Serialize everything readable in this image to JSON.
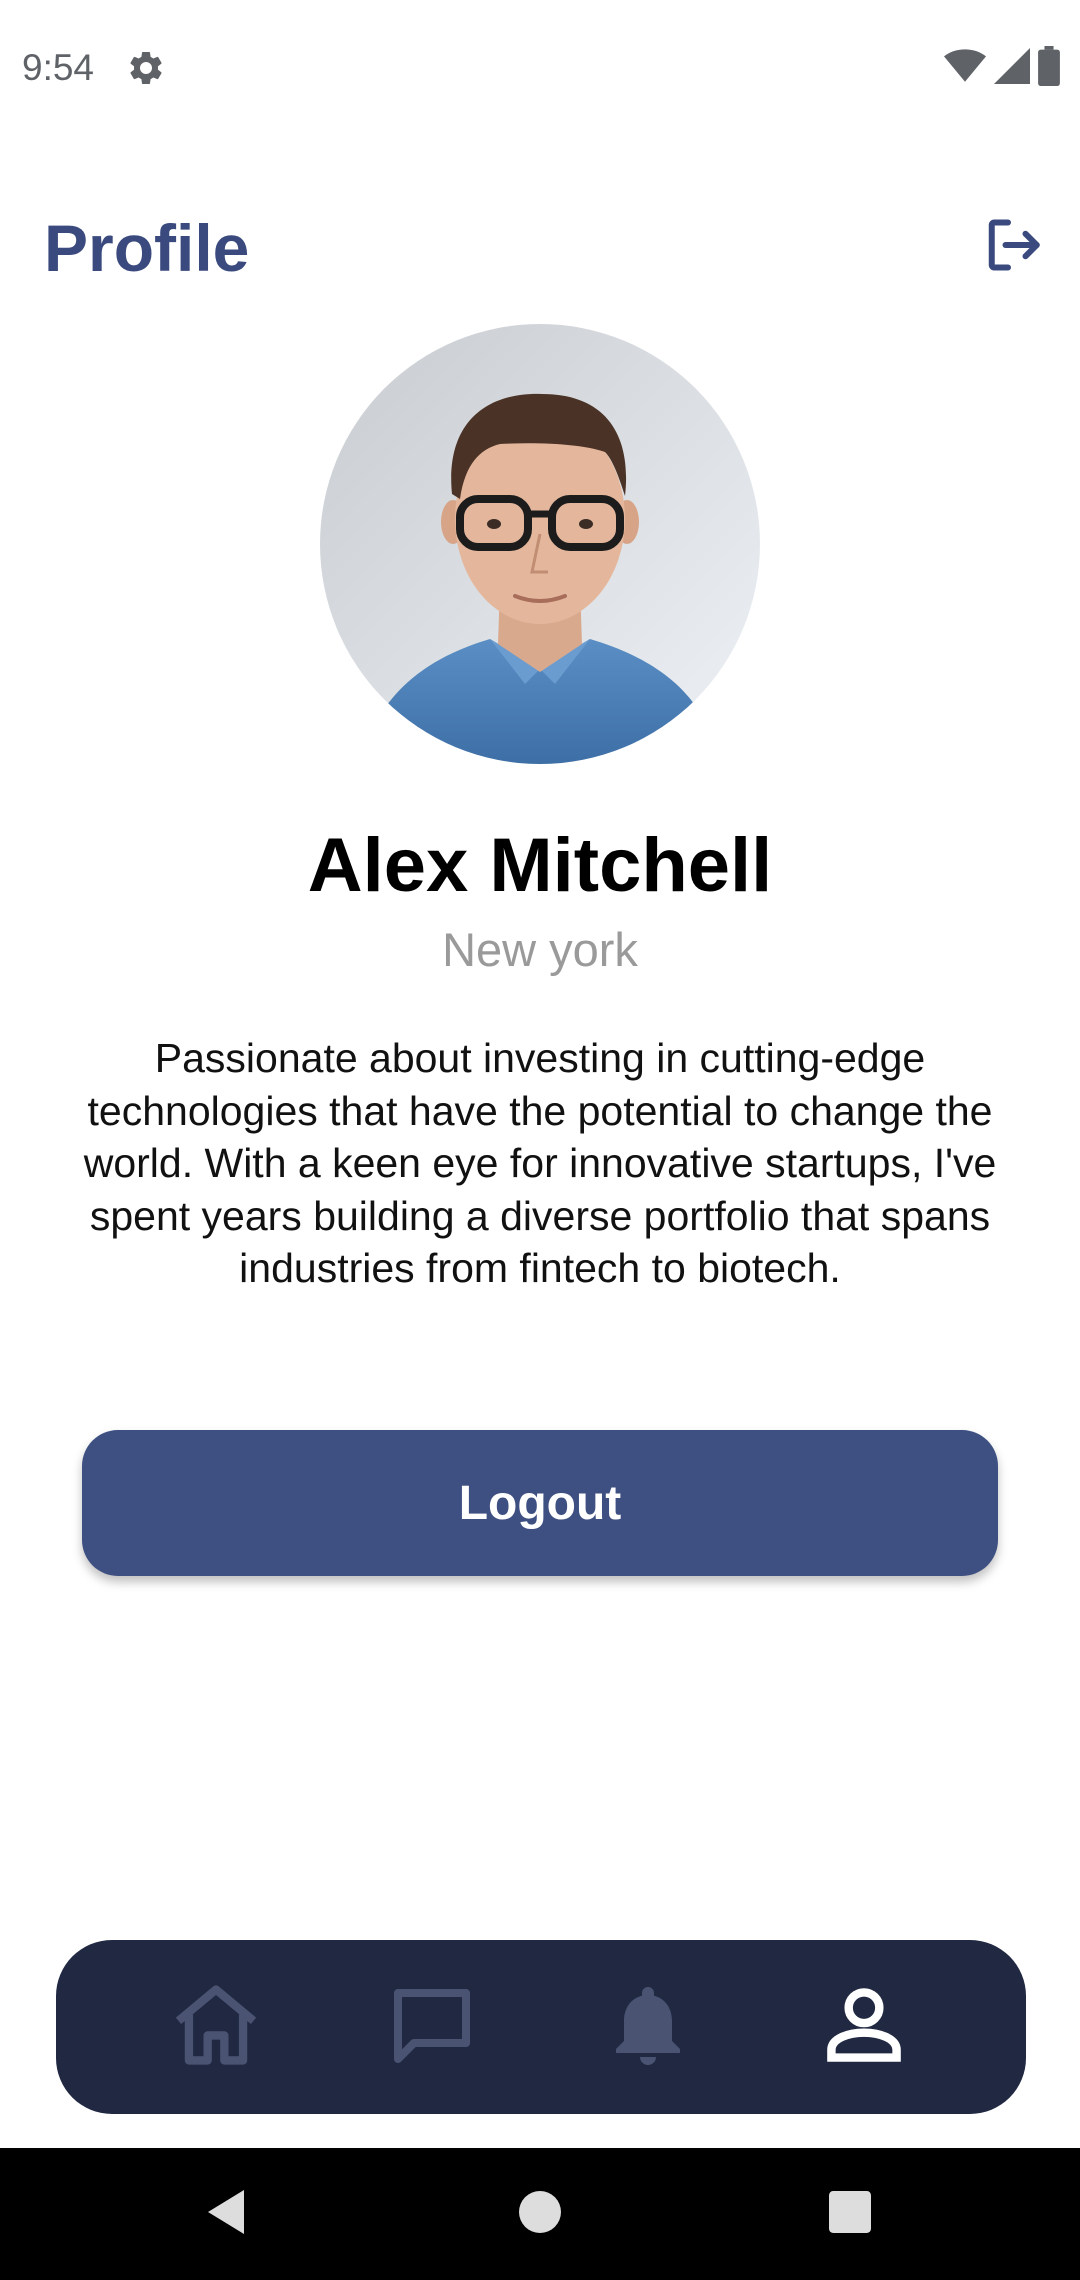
{
  "status_bar": {
    "time": "9:54",
    "icons": [
      "gear-icon",
      "wifi-icon",
      "signal-icon",
      "battery-icon"
    ]
  },
  "header": {
    "title": "Profile",
    "exit_icon": "logout-icon"
  },
  "profile": {
    "name": "Alex Mitchell",
    "location": "New york",
    "bio": "Passionate about investing in cutting-edge technologies that have the potential to change the world. With a keen eye for innovative startups, I've spent years building a diverse portfolio that spans industries from fintech to biotech."
  },
  "logout_button": {
    "label": "Logout"
  },
  "bottom_nav": {
    "items": [
      {
        "icon": "home-icon",
        "active": false
      },
      {
        "icon": "chat-icon",
        "active": false
      },
      {
        "icon": "bell-icon",
        "active": false
      },
      {
        "icon": "person-icon",
        "active": true
      }
    ]
  },
  "colors": {
    "accent": "#3b4a7e",
    "button": "#3e4f82",
    "nav_background": "#202842",
    "nav_inactive": "#4a5472",
    "nav_active": "#ffffff",
    "location_text": "#9a9a9a"
  }
}
